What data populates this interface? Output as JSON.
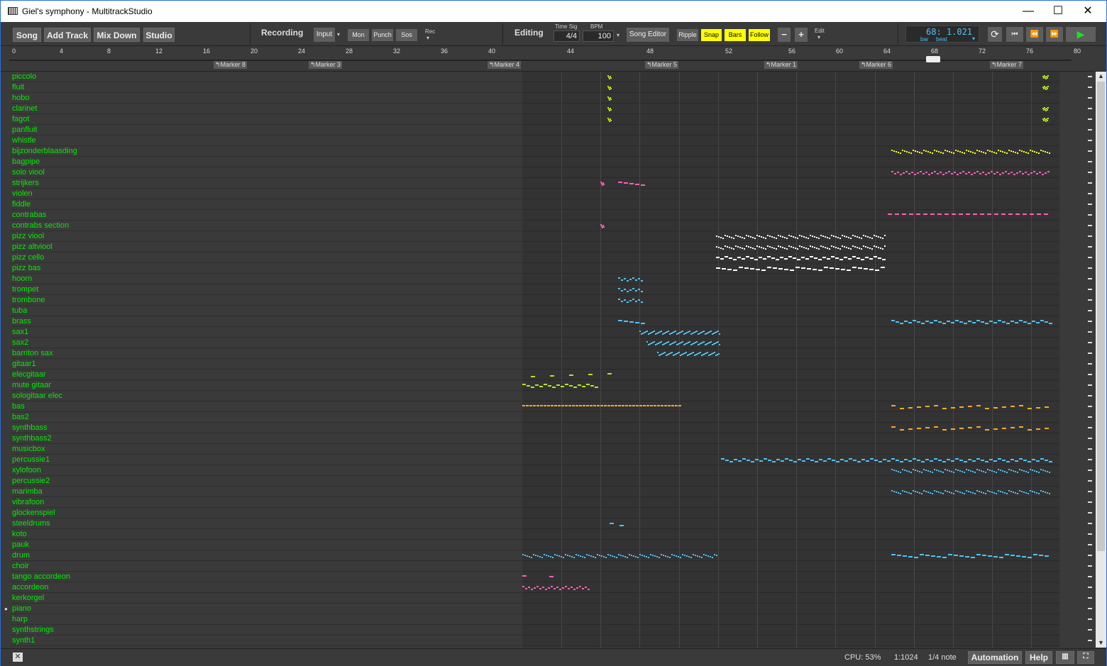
{
  "window": {
    "title": "Giel's symphony - MultitrackStudio",
    "minimize": "—",
    "maximize": "☐",
    "close": "✕"
  },
  "toolbar": {
    "song": "Song",
    "add_track": "Add Track",
    "mix_down": "Mix Down",
    "studio": "Studio",
    "recording": "Recording",
    "input": "Input",
    "mon": "Mon",
    "punch": "Punch",
    "sos": "Sos",
    "rec": "Rec",
    "editing": "Editing",
    "time_sig_label": "Time Sig",
    "time_sig": "4/4",
    "bpm_label": "BPM",
    "bpm": "100",
    "song_editor": "Song Editor",
    "ripple": "Ripple",
    "snap": "Snap",
    "bars": "Bars",
    "follow": "Follow",
    "minus": "−",
    "plus": "+",
    "edit": "Edit",
    "position": "68: 1.021",
    "bar_label": "bar",
    "beat_label": "beat"
  },
  "ruler": {
    "ticks": [
      "0",
      "4",
      "8",
      "12",
      "16",
      "20",
      "24",
      "28",
      "32",
      "36",
      "40",
      "44",
      "48",
      "52",
      "56",
      "60",
      "64",
      "68",
      "72",
      "76",
      "80"
    ],
    "markers": [
      "Marker 8",
      "Marker 3",
      "Marker 4",
      "Marker 5",
      "Marker 1",
      "Marker 6",
      "Marker 7"
    ]
  },
  "tracks": [
    "piccolo",
    "fluit",
    "hobo",
    "clarinet",
    "fagot",
    "panfluit",
    "whistle",
    "bijzonderblaasding",
    "bagpipe",
    "solo viool",
    "strijkers",
    "violen",
    "fiddle",
    "contrabas",
    "contrabs section",
    "pizz viool",
    "pizz altviool",
    "pizz cello",
    "pizz bas",
    "hoorn",
    "trompet",
    "trombone",
    "tuba",
    "brass",
    "sax1",
    "sax2",
    "barriton sax",
    "gitaar1",
    "elecgitaar",
    "mute gitaar",
    "sologitaar elec",
    "bas",
    "bas2",
    "synthbass",
    "synthbass2",
    "musicbox",
    "percussie1",
    "xylofoon",
    "percussie2",
    "marimba",
    "vibrafoon",
    "glockenspiel",
    "steeldrums",
    "koto",
    "pauk",
    "drum",
    "choir",
    "tango accordeon",
    "accordeon",
    "kerkorgel",
    "piano",
    "harp",
    "synthstrings",
    "synth1"
  ],
  "status": {
    "cpu": "CPU: 53%",
    "zoom": "1:1024",
    "grid": "1/4 note",
    "automation": "Automation",
    "help": "Help"
  },
  "colors": {
    "track_name": "#00ee00",
    "highlight": "#ffff00",
    "accent": "#4fc3f7"
  }
}
